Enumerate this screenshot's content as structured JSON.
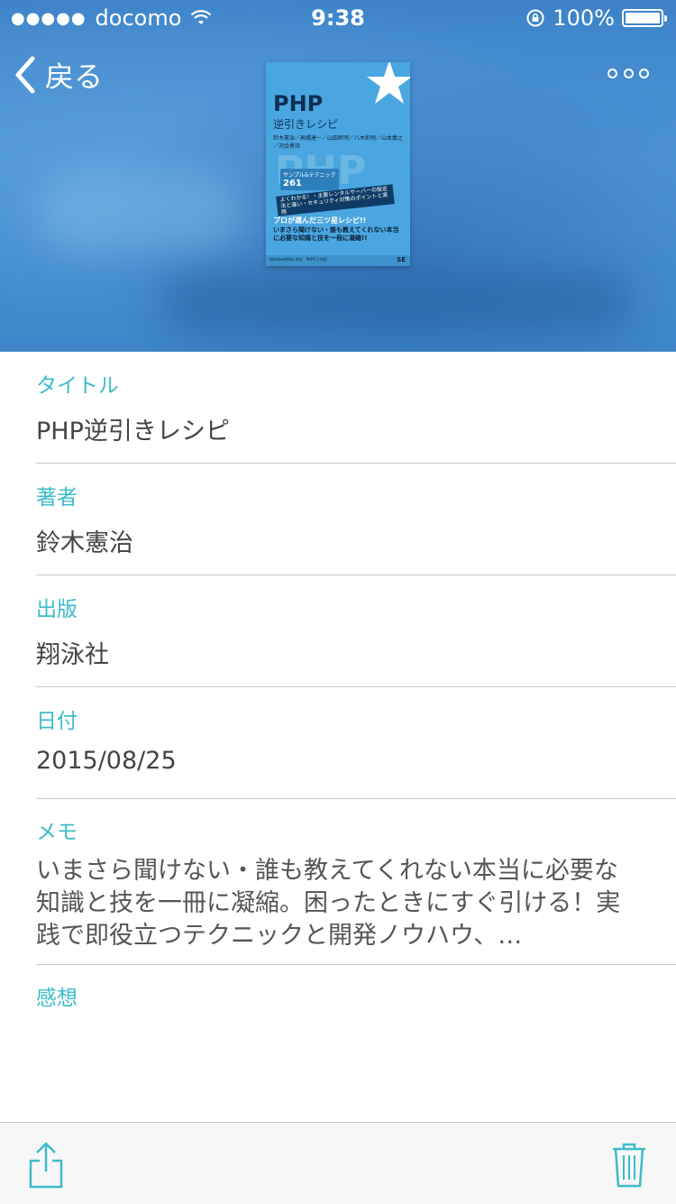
{
  "status_bar": {
    "carrier": "docomo",
    "time": "9:38",
    "battery_percent": "100%"
  },
  "nav": {
    "back_label": "戻る",
    "more_icon": "ellipsis-icon"
  },
  "cover": {
    "title": "PHP",
    "subtitle": "逆引きレシピ",
    "authors": "鈴木憲治／高橋達一／山田新明／八木則明／山本義之／河合勇持",
    "badge_label": "サンプル&テクニック",
    "badge_number": "261",
    "box_text": "よくわかる！・主要レンタルサーバーの設定法と違い・セキュリティ対策のポイントと実際",
    "promo": "プロが選んだ三ツ星レシピ!!",
    "headline": "いまさら聞けない・誰も教えてくれない本当に必要な知識と技を一冊に凝縮!!",
    "footer": "Windows/Mac 対応　PHP5.3 対応",
    "publisher_mark": "SE",
    "accent": "#4aa6e0"
  },
  "fields": {
    "title_label": "タイトル",
    "title_value": "PHP逆引きレシピ",
    "author_label": "著者",
    "author_value": "鈴木憲治",
    "publisher_label": "出版",
    "publisher_value": "翔泳社",
    "date_label": "日付",
    "date_value": "2015/08/25",
    "memo_label": "メモ",
    "memo_value": "いまさら聞けない・誰も教えてくれない本当に必要な知識と技を一冊に凝縮。困ったときにすぐ引ける！実践で即役立つテクニックと開発ノウハウ、…",
    "impression_label": "感想"
  },
  "toolbar": {
    "share_icon": "share-icon",
    "trash_icon": "trash-icon"
  },
  "colors": {
    "label": "#3cbcc9",
    "icon": "#3cbcc9",
    "header": "#4f97d6"
  }
}
